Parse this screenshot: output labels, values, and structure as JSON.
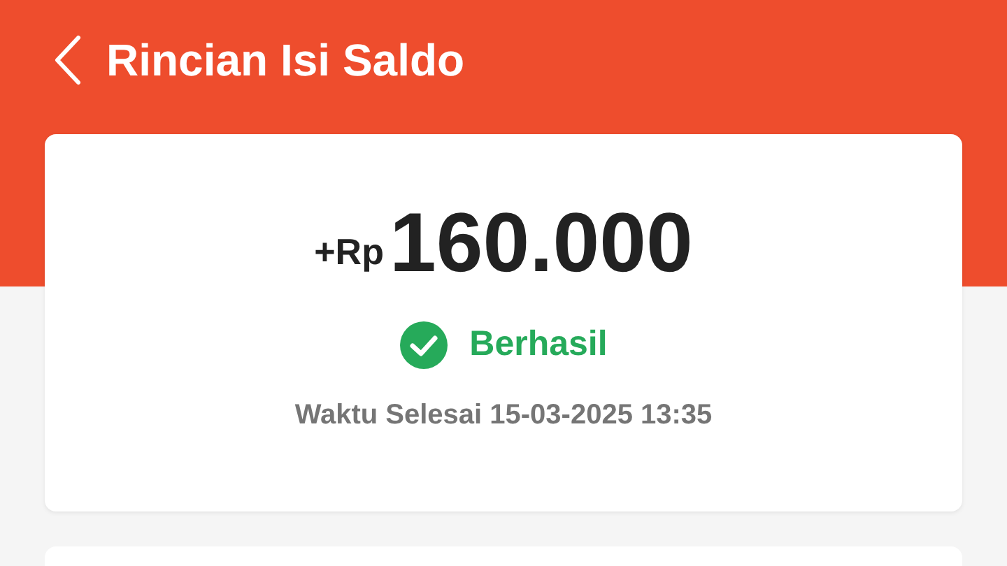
{
  "header": {
    "title": "Rincian Isi Saldo"
  },
  "summary": {
    "amount_prefix": "+Rp",
    "amount": "160.000",
    "status": {
      "kind": "success",
      "label": "Berhasil"
    },
    "time": "Waktu Selesai 15-03-2025 13:35"
  }
}
